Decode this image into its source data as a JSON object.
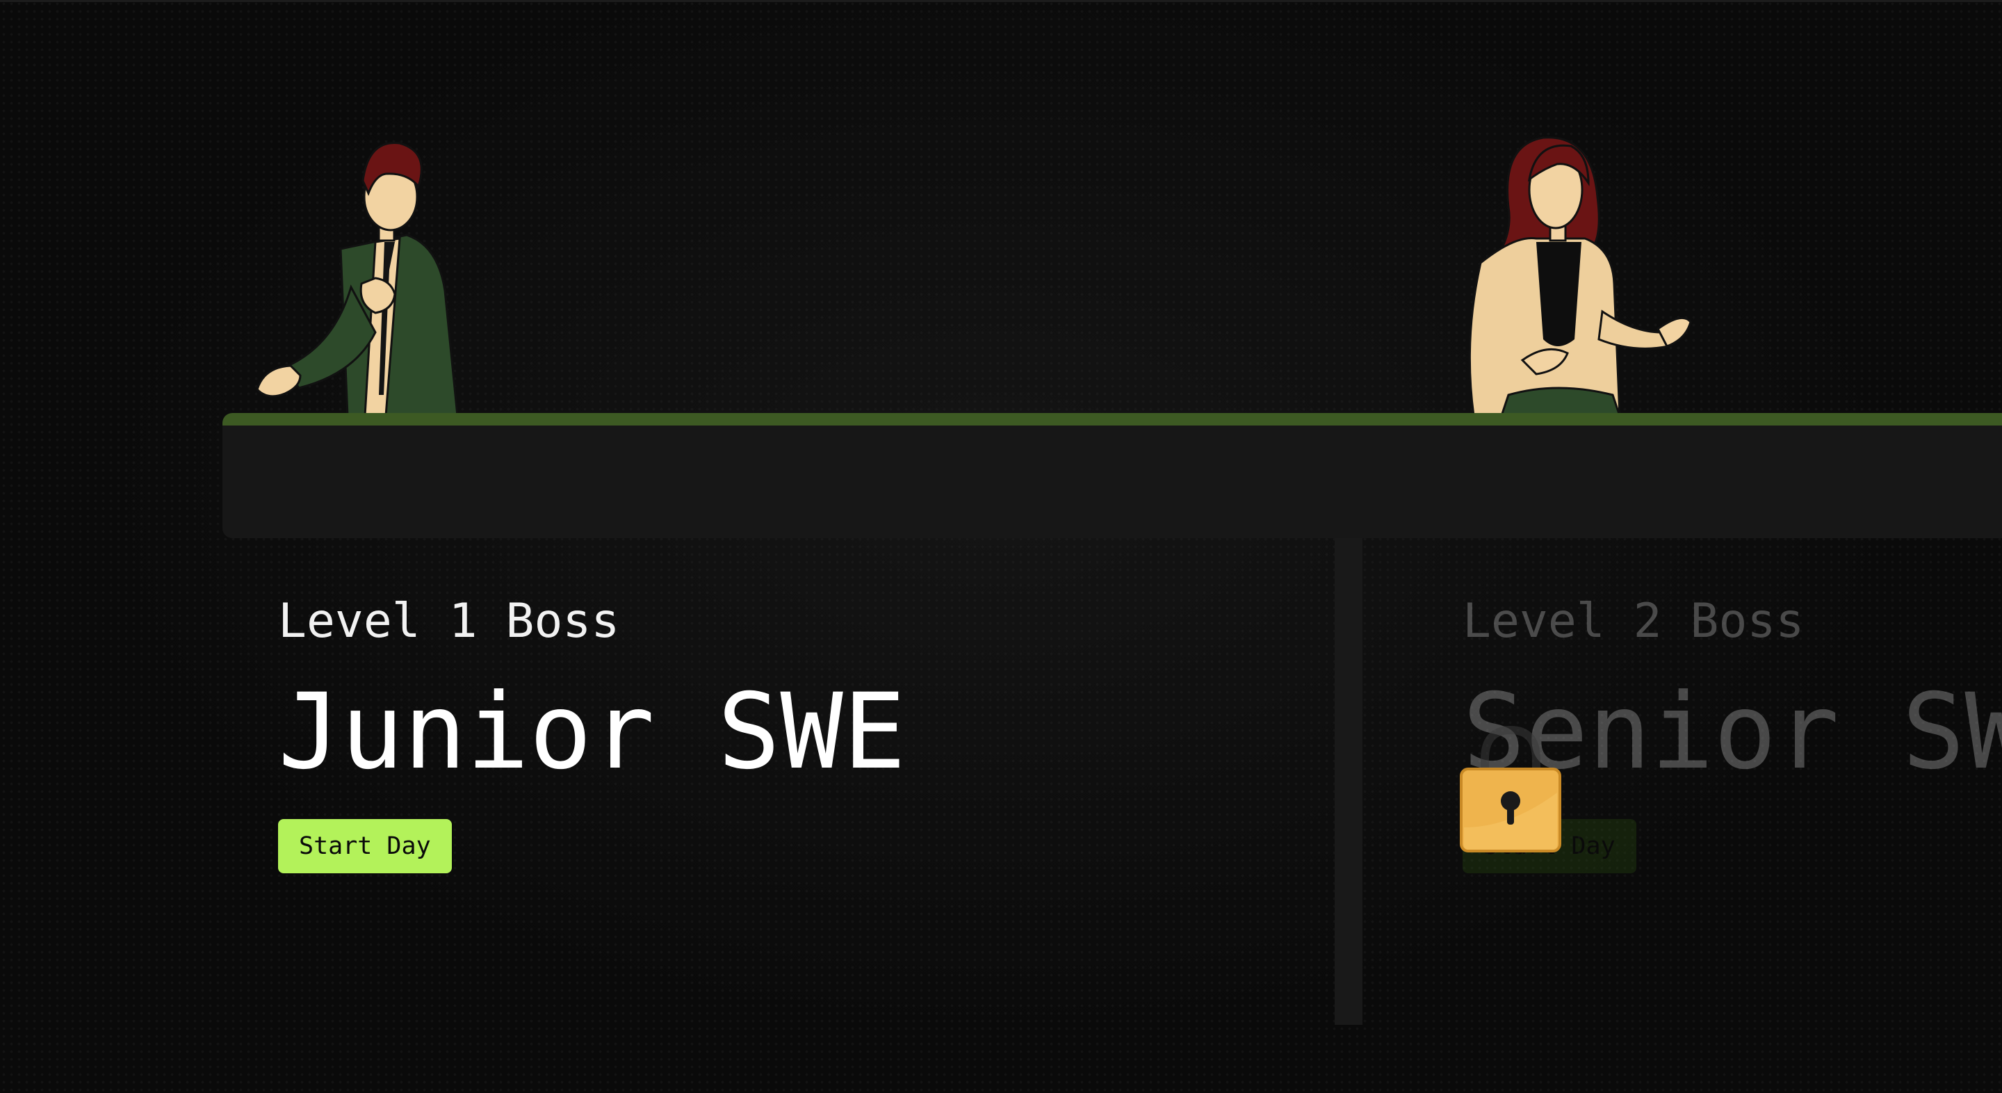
{
  "scene": {
    "colors": {
      "background": "#0a0a0a",
      "desk": "#171717",
      "desk_rim": "#3d5a23",
      "button_active": "#b3f25a",
      "button_locked": "#2f5a12",
      "lock": "#efb44d"
    }
  },
  "levels": [
    {
      "label": "Level 1 Boss",
      "name": "Junior SWE",
      "button_label": "Start Day",
      "locked": false,
      "character_icon": "junior-swe-character-icon"
    },
    {
      "label": "Level 2 Boss",
      "name": "Senior SWE",
      "button_label": "Start Day",
      "locked": true,
      "character_icon": "senior-swe-character-icon",
      "lock_icon": "padlock-icon"
    }
  ]
}
